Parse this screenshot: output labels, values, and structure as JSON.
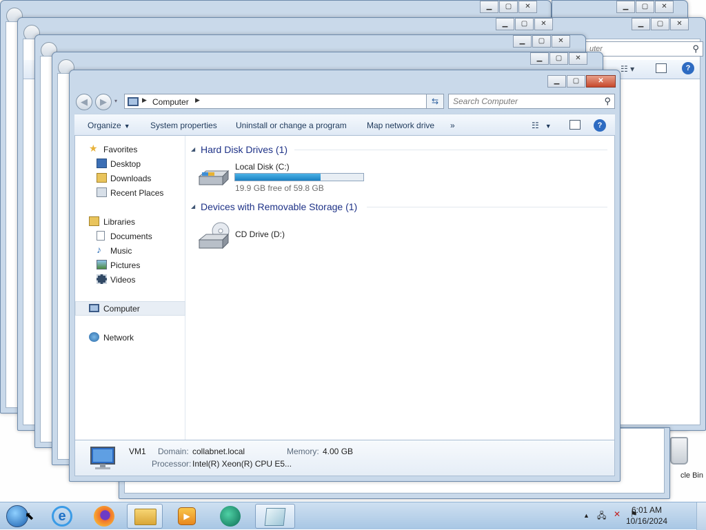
{
  "desktop": {
    "recycle_label": "cle Bin"
  },
  "window": {
    "address_label": "Computer",
    "search_placeholder": "Search Computer",
    "commands": {
      "organize": "Organize",
      "system_properties": "System properties",
      "uninstall": "Uninstall or change a program",
      "map_drive": "Map network drive",
      "more": "»"
    },
    "nav": {
      "favorites": "Favorites",
      "desktop": "Desktop",
      "downloads": "Downloads",
      "recent": "Recent Places",
      "libraries": "Libraries",
      "documents": "Documents",
      "music": "Music",
      "pictures": "Pictures",
      "videos": "Videos",
      "computer": "Computer",
      "network": "Network"
    },
    "groups": {
      "hdd": "Hard Disk Drives (1)",
      "removable": "Devices with Removable Storage (1)"
    },
    "drives": {
      "c_name": "Local Disk (C:)",
      "c_free": "19.9 GB free of 59.8 GB",
      "c_used_fraction": 0.667,
      "d_name": "CD Drive (D:)"
    },
    "details": {
      "name": "VM1",
      "domain_label": "Domain:",
      "domain_value": "collabnet.local",
      "memory_label": "Memory:",
      "memory_value": "4.00 GB",
      "processor_label": "Processor:",
      "processor_value": "Intel(R) Xeon(R) CPU E5..."
    }
  },
  "background_window": {
    "search_fragment": "uter"
  },
  "taskbar": {
    "time": "6:01 AM",
    "date": "10/16/2024"
  },
  "colors": {
    "accent": "#1a80c2",
    "group_header": "#1e3287",
    "taskbar": "#b9d1ea"
  }
}
